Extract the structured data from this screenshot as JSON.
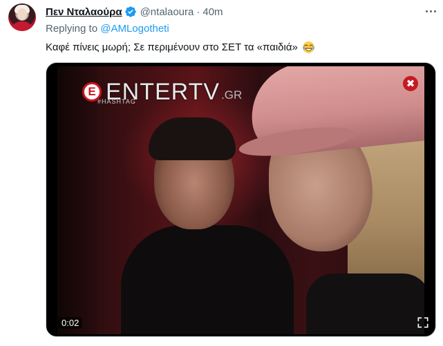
{
  "author": {
    "display_name": "Πεν Νταλαούρα",
    "handle": "@ntalaoura",
    "separator": "·",
    "time": "40m",
    "verified": true
  },
  "reply": {
    "prefix": "Replying to ",
    "mention": "@AMLogotheti"
  },
  "tweet": {
    "text": "Καφέ πίνεις μωρή; Σε περιμένουν στο ΣΕΤ τα «παιδιά»",
    "emoji": "face-with-tears-of-joy"
  },
  "media": {
    "type": "video",
    "timestamp": "0:02",
    "watermark": {
      "logo_letter": "E",
      "brand": "ENTERTV",
      "suffix": ".GR",
      "tag": "#HASHTAG"
    }
  },
  "icons": {
    "verified": "verified-badge-icon",
    "more": "more-options-icon",
    "fullscreen": "fullscreen-icon"
  },
  "colors": {
    "accent": "#1d9bf0",
    "secondary_text": "#536471",
    "primary_text": "#0f1419",
    "border": "#cfd9de"
  }
}
